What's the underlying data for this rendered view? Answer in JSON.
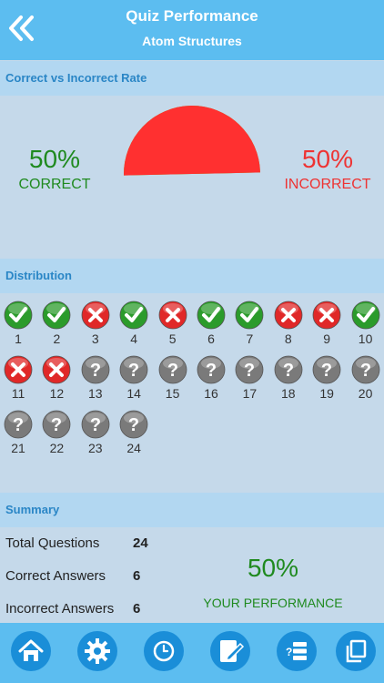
{
  "header": {
    "title": "Quiz Performance",
    "subtitle": "Atom Structures"
  },
  "rate_section": {
    "heading": "Correct vs Incorrect Rate",
    "correct_pct": "50%",
    "correct_label": "CORRECT",
    "incorrect_pct": "50%",
    "incorrect_label": "INCORRECT",
    "correct_fraction": 0.5,
    "colors": {
      "correct": "#7cb800",
      "incorrect": "#ff3030"
    }
  },
  "distribution": {
    "heading": "Distribution",
    "questions": [
      {
        "num": "1",
        "status": "correct"
      },
      {
        "num": "2",
        "status": "correct"
      },
      {
        "num": "3",
        "status": "incorrect"
      },
      {
        "num": "4",
        "status": "correct"
      },
      {
        "num": "5",
        "status": "incorrect"
      },
      {
        "num": "6",
        "status": "correct"
      },
      {
        "num": "7",
        "status": "correct"
      },
      {
        "num": "8",
        "status": "incorrect"
      },
      {
        "num": "9",
        "status": "incorrect"
      },
      {
        "num": "10",
        "status": "correct"
      },
      {
        "num": "11",
        "status": "incorrect"
      },
      {
        "num": "12",
        "status": "incorrect"
      },
      {
        "num": "13",
        "status": "unanswered"
      },
      {
        "num": "14",
        "status": "unanswered"
      },
      {
        "num": "15",
        "status": "unanswered"
      },
      {
        "num": "16",
        "status": "unanswered"
      },
      {
        "num": "17",
        "status": "unanswered"
      },
      {
        "num": "18",
        "status": "unanswered"
      },
      {
        "num": "19",
        "status": "unanswered"
      },
      {
        "num": "20",
        "status": "unanswered"
      },
      {
        "num": "21",
        "status": "unanswered"
      },
      {
        "num": "22",
        "status": "unanswered"
      },
      {
        "num": "23",
        "status": "unanswered"
      },
      {
        "num": "24",
        "status": "unanswered"
      }
    ]
  },
  "summary": {
    "heading": "Summary",
    "rows": [
      {
        "label": "Total Questions",
        "value": "24"
      },
      {
        "label": "Correct Answers",
        "value": "6"
      },
      {
        "label": "Incorrect Answers",
        "value": "6"
      }
    ],
    "performance_pct": "50%",
    "performance_label": "YOUR PERFORMANCE"
  },
  "toolbar": {
    "buttons": [
      {
        "icon": "home-icon"
      },
      {
        "icon": "gear-icon"
      },
      {
        "icon": "clock-icon"
      },
      {
        "icon": "edit-note-icon"
      },
      {
        "icon": "question-list-icon"
      },
      {
        "icon": "copy-icon"
      }
    ]
  }
}
